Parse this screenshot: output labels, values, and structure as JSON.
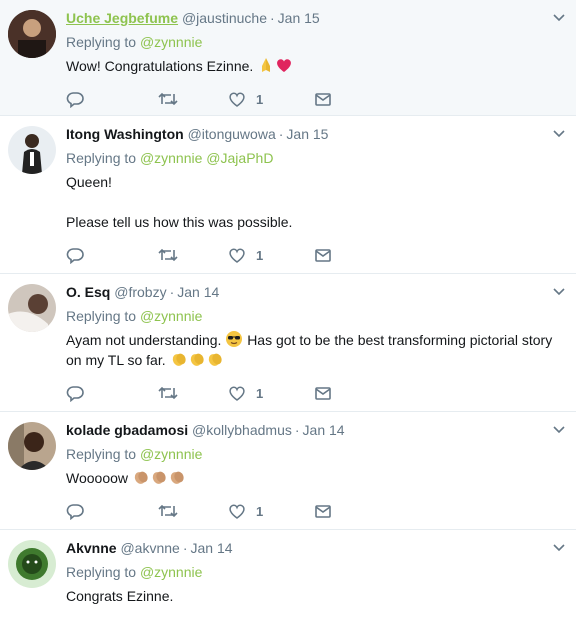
{
  "tweets": [
    {
      "name": "Uche Jegbefume",
      "handle": "@jaustinuche",
      "time": "Jan 15",
      "replying_label": "Replying to",
      "mentions": [
        "@zynnnie"
      ],
      "lines": [
        "Wow! Congratulations Ezinne."
      ],
      "emoji": [
        "pray-emoji",
        "heart-emoji"
      ],
      "likes": "1"
    },
    {
      "name": "Itong Washington",
      "handle": "@itonguwowa",
      "time": "Jan 15",
      "replying_label": "Replying to",
      "mentions": [
        "@zynnnie",
        "@JajaPhD"
      ],
      "lines": [
        "Queen!",
        "",
        "Please tell us how this was possible."
      ],
      "likes": "1"
    },
    {
      "name": "O. Esq",
      "handle": "@frobzy",
      "time": "Jan 14",
      "replying_label": "Replying to",
      "mentions": [
        "@zynnnie"
      ],
      "line_a": "Ayam not understanding.",
      "line_b": "Has got to be the best transforming pictorial story",
      "line_c": "on my TL so far.",
      "emoji": [
        "sunglasses-emoji",
        "clap-emoji"
      ],
      "likes": "1"
    },
    {
      "name": "kolade gbadamosi",
      "handle": "@kollybhadmus",
      "time": "Jan 14",
      "replying_label": "Replying to",
      "mentions": [
        "@zynnnie"
      ],
      "lines": [
        "Wooooow"
      ],
      "emoji": [
        "clap-emoji"
      ],
      "likes": "1"
    },
    {
      "name": "Akvnne",
      "handle": "@akvnne",
      "time": "Jan 14",
      "replying_label": "Replying to",
      "mentions": [
        "@zynnnie"
      ],
      "lines": [
        "Congrats Ezinne."
      ]
    }
  ],
  "colors": {
    "accent": "#8ec34f",
    "muted": "#657786",
    "highlight_bg": "#f5f8fa",
    "heart": "#e0245e"
  },
  "icons": [
    "reply-icon",
    "retweet-icon",
    "like-icon",
    "message-icon",
    "chevron-down-icon"
  ]
}
